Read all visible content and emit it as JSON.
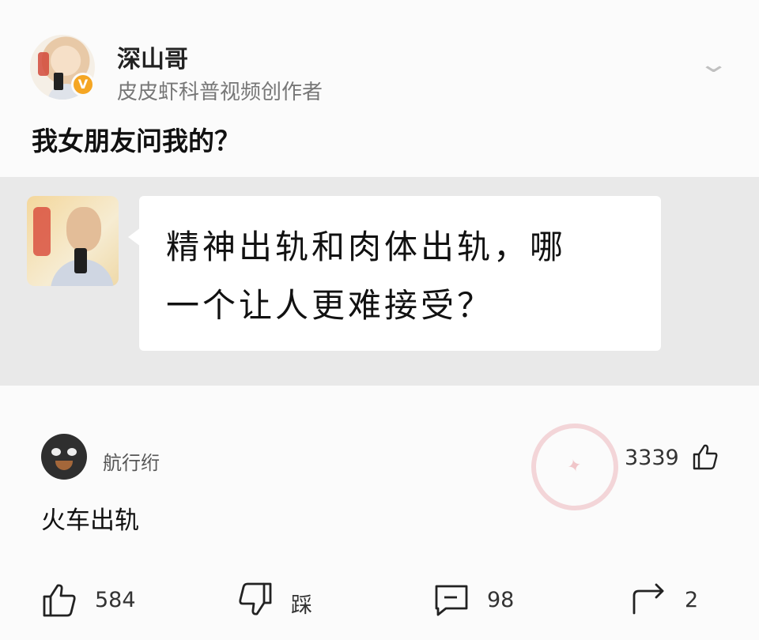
{
  "author": {
    "name": "深山哥",
    "description": "皮皮虾科普视频创作者",
    "verified_icon": "v-badge-icon",
    "menu_icon": "chevron-down-icon"
  },
  "post": {
    "title": "我女朋友问我的？"
  },
  "quoted_image": {
    "line1": "精神出轨和肉体出轨，哪",
    "line2": "一个让人更难接受？"
  },
  "comment": {
    "username": "航行绗",
    "like_count": "3339",
    "text": "火车出轨"
  },
  "actions": {
    "like_count": "584",
    "dislike_label": "踩",
    "comment_count": "98",
    "share_count": "2"
  },
  "colors": {
    "accent_verified": "#f5a623",
    "card_bg": "#e9e9e9"
  }
}
